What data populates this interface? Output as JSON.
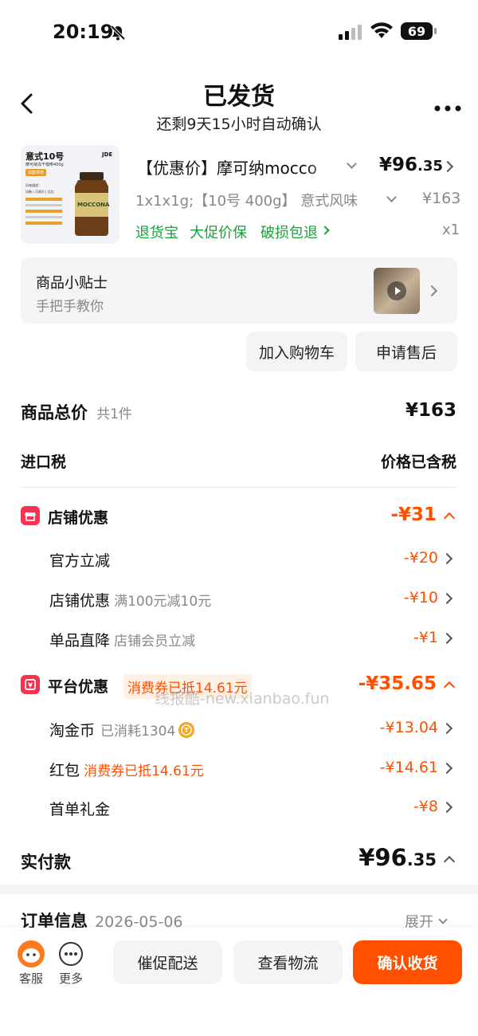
{
  "status_bar": {
    "time": "20:19",
    "battery": "69"
  },
  "header": {
    "title": "已发货",
    "subtitle": "还剩9天15小时自动确认"
  },
  "product": {
    "image_title": "意式10号",
    "image_sub": "摩可纳冻干咖啡400g",
    "image_tag": "浓醇烘焙",
    "image_lines": [
      "风味描述：",
      "均衡 | 可调方 | 比比"
    ],
    "image_brand": "JDE",
    "image_label": "MOCCONA",
    "name": "【优惠价】摩可纳mocco",
    "price_yuan": "¥96",
    "price_decimal": ".35",
    "spec": "1x1x1g;【10号 400g】 意式风味",
    "orig_price": "¥163",
    "services": [
      "退货宝",
      "大促价保",
      "破损包退"
    ],
    "qty": "x1"
  },
  "tips": {
    "title": "商品小贴士",
    "sub": "手把手教你"
  },
  "actions": {
    "add_cart": "加入购物车",
    "after_sale": "申请售后"
  },
  "summary": {
    "total_label": "商品总价",
    "total_count": "共1件",
    "total_value": "¥163",
    "tax_label": "进口税",
    "tax_value": "价格已含税"
  },
  "store_discount": {
    "label": "店铺优惠",
    "value": "-¥31",
    "items": [
      {
        "label": "官方立减",
        "note": "",
        "value": "-¥20"
      },
      {
        "label": "店铺优惠",
        "note": "满100元减10元",
        "value": "-¥10"
      },
      {
        "label": "单品直降",
        "note": "店铺会员立减",
        "value": "-¥1"
      }
    ]
  },
  "platform_discount": {
    "label": "平台优惠",
    "tag": "消费券已抵14.61元",
    "value": "-¥35.65",
    "items": [
      {
        "label": "淘金币",
        "note": "已消耗1304",
        "value": "-¥13.04"
      },
      {
        "label": "红包",
        "note": "消费券已抵14.61元",
        "value": "-¥14.61"
      },
      {
        "label": "首单礼金",
        "note": "",
        "value": "-¥8"
      }
    ]
  },
  "watermark": "线报酷-new.xianbao.fun",
  "paid": {
    "label": "实付款",
    "yuan": "¥96",
    "decimal": ".35"
  },
  "order_info": {
    "label": "订单信息",
    "date": "2026-05-06",
    "expand": "展开"
  },
  "bottom_bar": {
    "service": "客服",
    "more": "更多",
    "urge": "催促配送",
    "logistics": "查看物流",
    "confirm": "确认收货"
  },
  "colors": {
    "accent": "#ff5000",
    "green": "#15a33a",
    "badge": "#f5334f"
  }
}
